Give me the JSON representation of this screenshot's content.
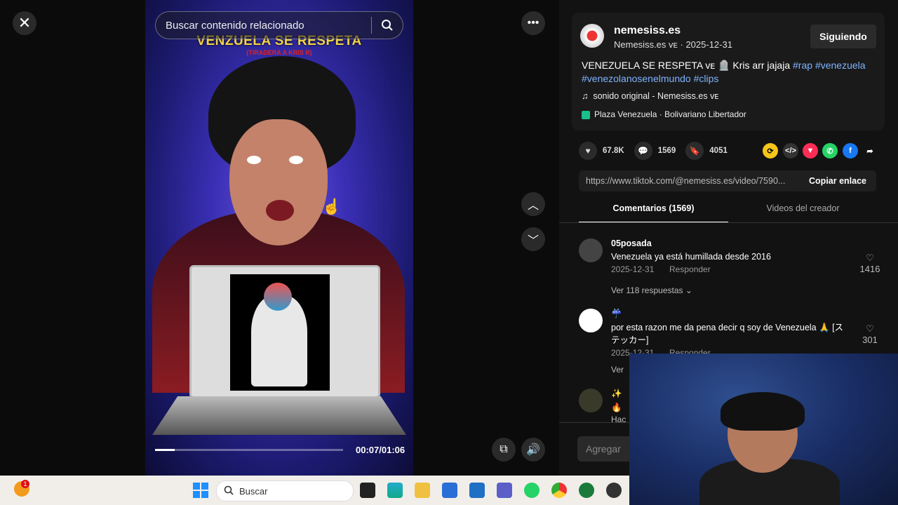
{
  "player": {
    "search_placeholder": "Buscar contenido relacionado",
    "video_title": "VENZUELA SE RESPETA",
    "video_subtitle": "(TIRADERA A KRIS R)",
    "time": "00:07/01:06",
    "progress": 0.106
  },
  "creator": {
    "username": "nemesiss.es",
    "handle_line": "Nemesiss.es ᴠᴇ · 2025-12-31",
    "follow_label": "Siguiendo"
  },
  "post": {
    "desc_main": "VENEZUELA SE RESPETA ᴠᴇ 🪦 Kris arr jajaja ",
    "tags": [
      "#rap",
      "#venezuela",
      "#venezolanosenelmundo",
      "#clips"
    ],
    "sound": "sonido original - Nemesiss.es ᴠᴇ",
    "location": "Plaza Venezuela · Bolivariano Libertador"
  },
  "stats": {
    "likes": "67.8K",
    "comments": "1569",
    "saves": "4051"
  },
  "share": {
    "url": "https://www.tiktok.com/@nemesiss.es/video/7590...",
    "copy_label": "Copiar enlace"
  },
  "tabs": {
    "comments": "Comentarios (1569)",
    "videos": "Videos del creador"
  },
  "comments": [
    {
      "user": "05posada",
      "text": "Venezuela ya está humillada desde 2016",
      "date": "2025-12-31",
      "reply": "Responder",
      "likes": "1416",
      "more": "Ver 118 respuestas"
    },
    {
      "user": "☔",
      "text": "por esta razon me da pena decir q soy de Venezuela 🙏 [ステッカー]",
      "date": "2025-12-31",
      "reply": "Responder",
      "likes": "301",
      "more": "Ver"
    },
    {
      "user": "✨",
      "text": "🔥",
      "more": "Hac"
    }
  ],
  "comment_input_placeholder": "Agregar",
  "taskbar": {
    "search_label": "Buscar",
    "notification_count": "1"
  }
}
